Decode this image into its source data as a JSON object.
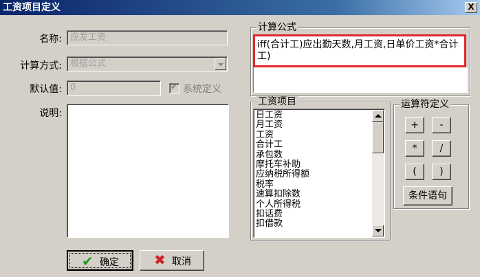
{
  "window": {
    "title": "工资项目定义",
    "close_glyph": "X"
  },
  "form": {
    "name_label": "名称:",
    "name_value": "应发工资",
    "calc_label": "计算方式:",
    "calc_value": "根据公式",
    "default_label": "默认值:",
    "default_value": "0",
    "system_def_label": "系统定义",
    "desc_label": "说明:"
  },
  "formula": {
    "group_title": "计算公式",
    "text": "iff(合计工)应出勤天数,月工资,日单价工资*合计工)"
  },
  "items": {
    "group_title": "工资项目",
    "list": [
      "日工资",
      "月工资",
      "工资",
      "合计工",
      "承包数",
      "摩托车补助",
      "应纳税所得额",
      "税率",
      "速算扣除数",
      "个人所得税",
      "扣话费",
      "扣借款"
    ]
  },
  "operators": {
    "group_title": "运算符定义",
    "plus": "+",
    "minus": "-",
    "multiply": "*",
    "divide": "/",
    "lparen": "(",
    "rparen": ")",
    "condition": "条件语句"
  },
  "buttons": {
    "ok": "确定",
    "cancel": "取消"
  },
  "colors": {
    "highlight_border": "#e0262b",
    "ok_icon": "#1a9a1a",
    "cancel_icon": "#d02020"
  }
}
